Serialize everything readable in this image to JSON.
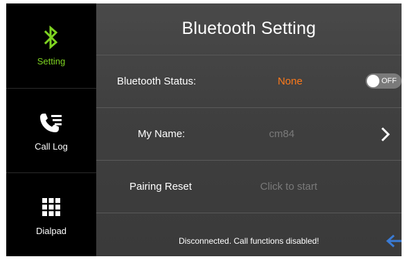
{
  "sidebar": {
    "items": [
      {
        "label": "Setting",
        "icon": "bluetooth-icon",
        "active": true
      },
      {
        "label": "Call Log",
        "icon": "call-log-icon",
        "active": false
      },
      {
        "label": "Dialpad",
        "icon": "dialpad-icon",
        "active": false
      }
    ]
  },
  "header": {
    "title": "Bluetooth Setting"
  },
  "settings": {
    "status": {
      "label": "Bluetooth Status:",
      "value": "None",
      "toggle_text": "OFF"
    },
    "name": {
      "label": "My Name:",
      "value": "cm84"
    },
    "pairing": {
      "label": "Pairing Reset",
      "value": "Click to start"
    }
  },
  "footer": {
    "status_message": "Disconnected. Call functions disabled!"
  },
  "colors": {
    "accent_green": "#7ed321",
    "status_orange": "#ff7a1a",
    "arrow_blue": "#3a7bd5"
  },
  "icons": [
    "bluetooth-icon",
    "call-log-icon",
    "dialpad-icon",
    "chevron-right-icon",
    "back-arrow-icon"
  ]
}
